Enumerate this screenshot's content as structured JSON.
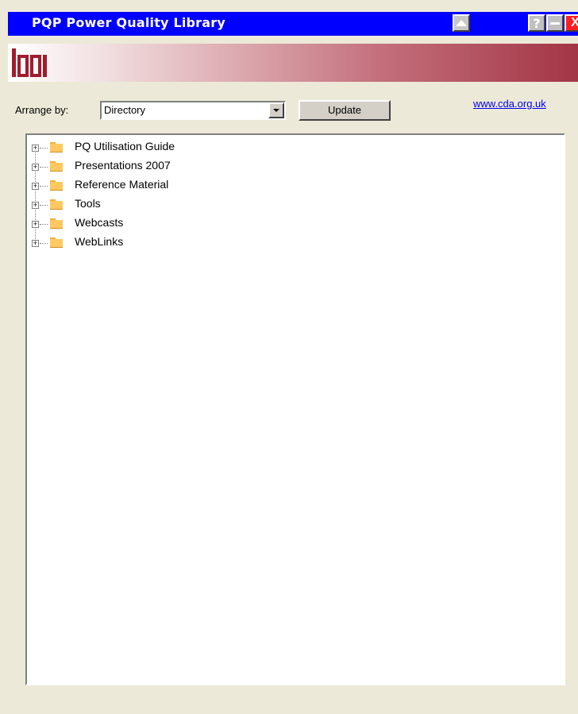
{
  "window": {
    "title": "PQP Power Quality Library",
    "help_label": "?",
    "close_label": "X"
  },
  "banner": {
    "logo_text": "lpqi"
  },
  "toolbar": {
    "arrange_label": "Arrange by:",
    "arrange_value": "Directory",
    "update_label": "Update",
    "link_text": "www.cda.org.uk"
  },
  "tree": {
    "items": [
      {
        "label": "PQ Utilisation Guide",
        "icon": "folder-icon"
      },
      {
        "label": "Presentations 2007",
        "icon": "folder-icon"
      },
      {
        "label": "Reference Material",
        "icon": "folder-icon"
      },
      {
        "label": "Tools",
        "icon": "folder-icon"
      },
      {
        "label": "Webcasts",
        "icon": "folder-icon"
      },
      {
        "label": "WebLinks",
        "icon": "folder-icon"
      }
    ]
  }
}
